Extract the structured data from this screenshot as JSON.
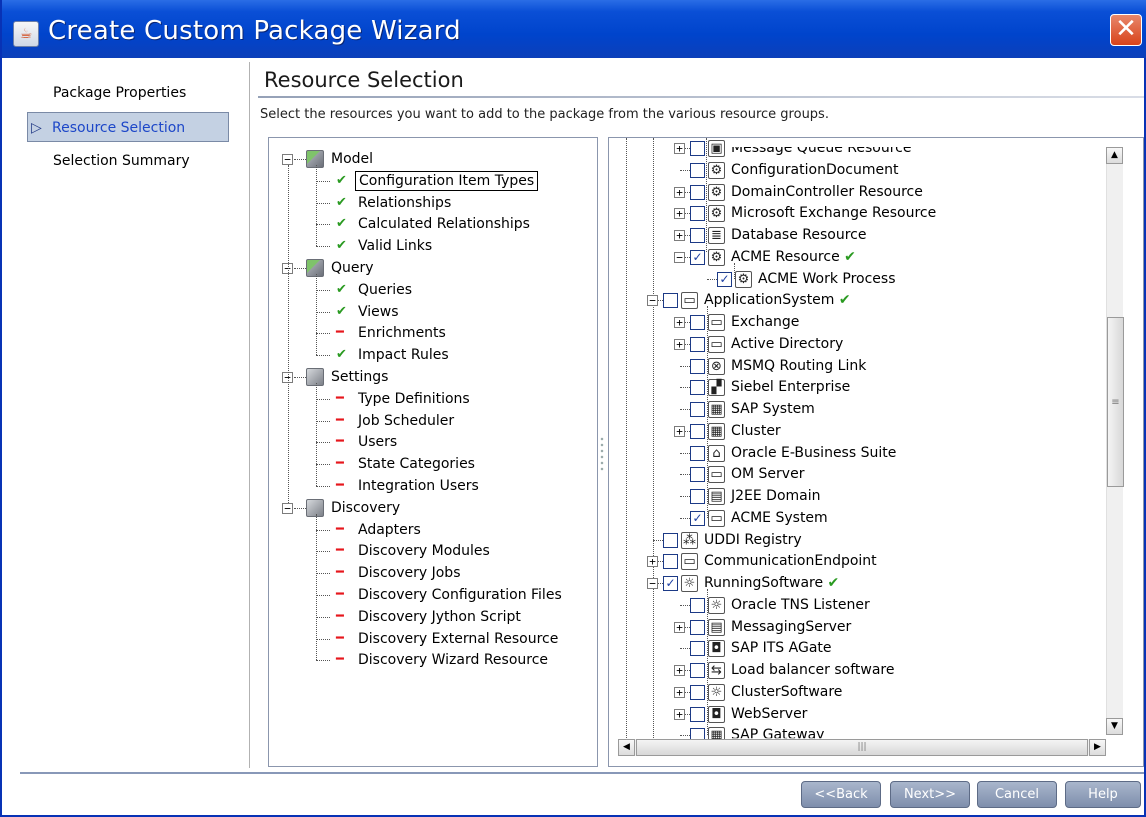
{
  "window": {
    "title": "Create Custom Package Wizard",
    "app_icon": "java-cup-icon"
  },
  "nav": {
    "items": [
      {
        "label": "Package Properties",
        "selected": false
      },
      {
        "label": "Resource Selection",
        "selected": true
      },
      {
        "label": "Selection Summary",
        "selected": false
      }
    ],
    "selected_marker": "▷"
  },
  "main": {
    "heading": "Resource Selection",
    "instruction": "Select the resources you want to add to the package from the various resource groups."
  },
  "left_tree": [
    {
      "label": "Model",
      "kind": "group",
      "icon": "cube-green-icon"
    },
    {
      "label": "Configuration Item Types",
      "kind": "child",
      "status": "check",
      "selected": true
    },
    {
      "label": "Relationships",
      "kind": "child",
      "status": "check"
    },
    {
      "label": "Calculated Relationships",
      "kind": "child",
      "status": "check"
    },
    {
      "label": "Valid Links",
      "kind": "child",
      "status": "check"
    },
    {
      "label": "Query",
      "kind": "group",
      "icon": "cube-green-icon"
    },
    {
      "label": "Queries",
      "kind": "child",
      "status": "check"
    },
    {
      "label": "Views",
      "kind": "child",
      "status": "check"
    },
    {
      "label": "Enrichments",
      "kind": "child",
      "status": "dash"
    },
    {
      "label": "Impact Rules",
      "kind": "child",
      "status": "check"
    },
    {
      "label": "Settings",
      "kind": "group",
      "icon": "cube-gray-icon"
    },
    {
      "label": "Type Definitions",
      "kind": "child",
      "status": "dash"
    },
    {
      "label": "Job Scheduler",
      "kind": "child",
      "status": "dash"
    },
    {
      "label": "Users",
      "kind": "child",
      "status": "dash"
    },
    {
      "label": "State Categories",
      "kind": "child",
      "status": "dash"
    },
    {
      "label": "Integration Users",
      "kind": "child",
      "status": "dash"
    },
    {
      "label": "Discovery",
      "kind": "group",
      "icon": "cube-gray-icon"
    },
    {
      "label": "Adapters",
      "kind": "child",
      "status": "dash"
    },
    {
      "label": "Discovery Modules",
      "kind": "child",
      "status": "dash"
    },
    {
      "label": "Discovery Jobs",
      "kind": "child",
      "status": "dash"
    },
    {
      "label": "Discovery Configuration Files",
      "kind": "child",
      "status": "dash"
    },
    {
      "label": "Discovery Jython Script",
      "kind": "child",
      "status": "dash"
    },
    {
      "label": "Discovery External Resource",
      "kind": "child",
      "status": "dash"
    },
    {
      "label": "Discovery Wizard Resource",
      "kind": "child",
      "status": "dash"
    }
  ],
  "status_glyphs": {
    "check": "✔",
    "dash": "━"
  },
  "right_tree": [
    {
      "label": "Message Queue Resource",
      "level": 3,
      "expander": true,
      "checked": false,
      "icon": "queue-icon",
      "partial": true
    },
    {
      "label": "ConfigurationDocument",
      "level": 3,
      "expander": false,
      "checked": false,
      "icon": "document-icon"
    },
    {
      "label": "DomainController Resource",
      "level": 3,
      "expander": true,
      "checked": false,
      "icon": "domain-icon"
    },
    {
      "label": "Microsoft Exchange Resource",
      "level": 3,
      "expander": true,
      "checked": false,
      "icon": "exchange-icon"
    },
    {
      "label": "Database Resource",
      "level": 3,
      "expander": true,
      "checked": false,
      "icon": "database-icon"
    },
    {
      "label": "ACME Resource",
      "level": 3,
      "expander": true,
      "expanded": true,
      "checked": true,
      "icon": "resource-icon",
      "done": true
    },
    {
      "label": "ACME Work Process",
      "level": 4,
      "expander": false,
      "checked": true,
      "icon": "resource-icon"
    },
    {
      "label": "ApplicationSystem",
      "level": 2,
      "expander": true,
      "expanded": true,
      "checked": false,
      "icon": "app-system-icon",
      "done": true
    },
    {
      "label": "Exchange",
      "level": 3,
      "expander": true,
      "checked": false,
      "icon": "app-system-icon"
    },
    {
      "label": "Active Directory",
      "level": 3,
      "expander": true,
      "checked": false,
      "icon": "app-system-icon"
    },
    {
      "label": "MSMQ Routing Link",
      "level": 3,
      "expander": false,
      "checked": false,
      "icon": "msmq-icon"
    },
    {
      "label": "Siebel Enterprise",
      "level": 3,
      "expander": false,
      "checked": false,
      "icon": "siebel-icon"
    },
    {
      "label": "SAP System",
      "level": 3,
      "expander": false,
      "checked": false,
      "icon": "sap-icon"
    },
    {
      "label": "Cluster",
      "level": 3,
      "expander": true,
      "checked": false,
      "icon": "cluster-icon"
    },
    {
      "label": "Oracle E-Business Suite",
      "level": 3,
      "expander": false,
      "checked": false,
      "icon": "oracle-icon"
    },
    {
      "label": "OM Server",
      "level": 3,
      "expander": false,
      "checked": false,
      "icon": "app-system-icon"
    },
    {
      "label": "J2EE Domain",
      "level": 3,
      "expander": false,
      "checked": false,
      "icon": "j2ee-icon"
    },
    {
      "label": "ACME System",
      "level": 3,
      "expander": false,
      "checked": true,
      "icon": "app-system-icon"
    },
    {
      "label": "UDDI Registry",
      "level": 2,
      "expander": false,
      "checked": false,
      "icon": "uddi-icon"
    },
    {
      "label": "CommunicationEndpoint",
      "level": 2,
      "expander": true,
      "checked": false,
      "icon": "endpoint-icon"
    },
    {
      "label": "RunningSoftware",
      "level": 2,
      "expander": true,
      "expanded": true,
      "checked": true,
      "icon": "gear-icon",
      "done": true
    },
    {
      "label": "Oracle TNS Listener",
      "level": 3,
      "expander": false,
      "checked": false,
      "icon": "gear-icon"
    },
    {
      "label": "MessagingServer",
      "level": 3,
      "expander": true,
      "checked": false,
      "icon": "server-icon"
    },
    {
      "label": "SAP ITS AGate",
      "level": 3,
      "expander": false,
      "checked": false,
      "icon": "web-server-icon"
    },
    {
      "label": "Load balancer software",
      "level": 3,
      "expander": true,
      "checked": false,
      "icon": "load-balancer-icon"
    },
    {
      "label": "ClusterSoftware",
      "level": 3,
      "expander": true,
      "checked": false,
      "icon": "gear-icon"
    },
    {
      "label": "WebServer",
      "level": 3,
      "expander": true,
      "checked": false,
      "icon": "web-server-icon"
    },
    {
      "label": "SAP Gateway",
      "level": 3,
      "expander": false,
      "checked": false,
      "icon": "sap-gateway-icon",
      "partial": true
    }
  ],
  "footer": {
    "back": "<<Back",
    "next": "Next>>",
    "cancel": "Cancel",
    "help": "Help"
  },
  "colors": {
    "titlebar": "#0044cc",
    "accent": "#1d47c8",
    "check": "#2a9a21",
    "dash": "#e6161c",
    "button": "#8c9bb6"
  }
}
